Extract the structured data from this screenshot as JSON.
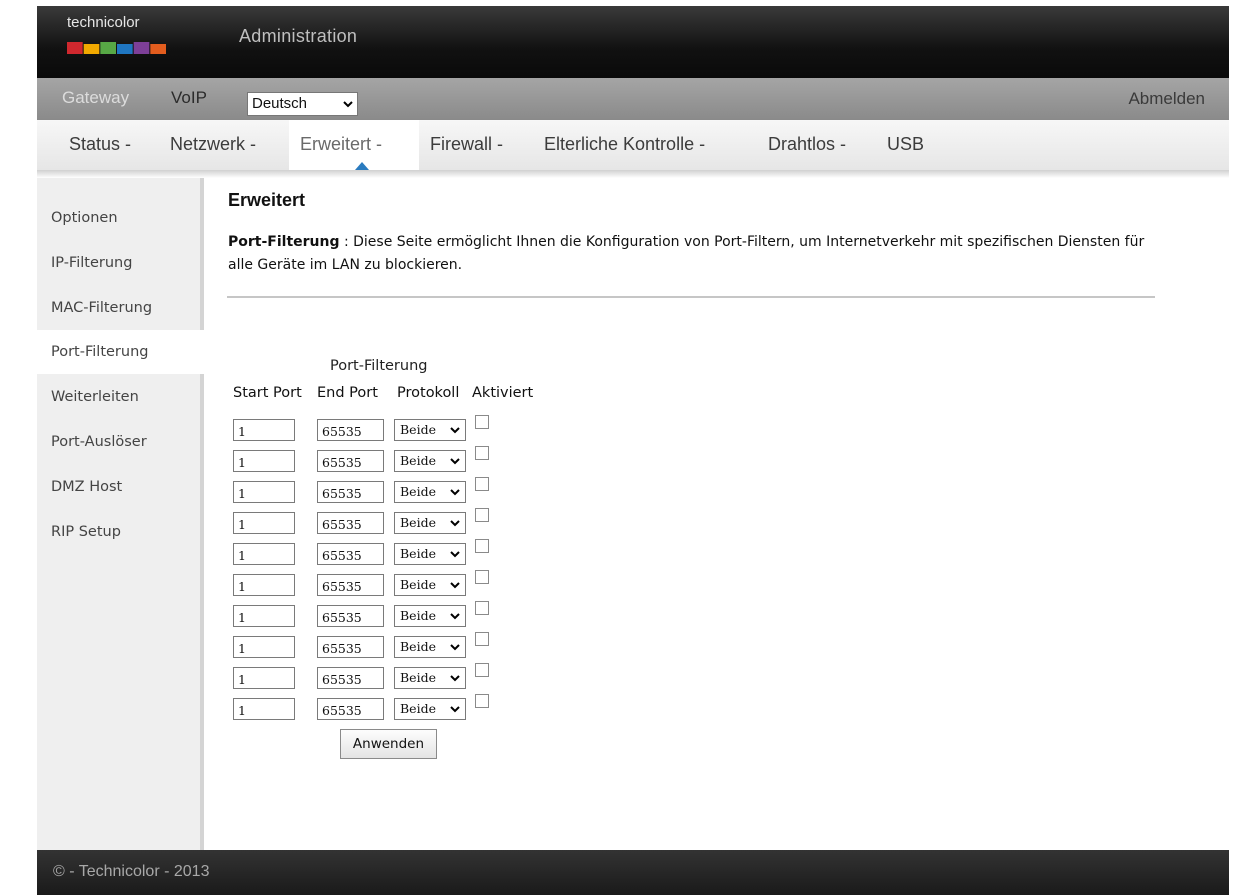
{
  "brand": {
    "logo_text": "technicolor",
    "bar_colors": [
      "#d0282e",
      "#f2a900",
      "#57a845",
      "#1f76c1",
      "#7d3f98",
      "#e35d1e"
    ]
  },
  "header": {
    "title": "Administration"
  },
  "topnav": {
    "gateway": "Gateway",
    "voip": "VoIP",
    "language": "Deutsch",
    "logout": "Abmelden"
  },
  "tabs": [
    {
      "label": "Status -"
    },
    {
      "label": "Netzwerk -"
    },
    {
      "label": "Erweitert -",
      "active": true
    },
    {
      "label": "Firewall -"
    },
    {
      "label": "Elterliche Kontrolle -"
    },
    {
      "label": "Drahtlos -"
    },
    {
      "label": "USB"
    }
  ],
  "sidebar": [
    {
      "label": "Optionen"
    },
    {
      "label": "IP-Filterung"
    },
    {
      "label": "MAC-Filterung"
    },
    {
      "label": "Port-Filterung",
      "active": true
    },
    {
      "label": "Weiterleiten"
    },
    {
      "label": "Port-Auslöser"
    },
    {
      "label": "DMZ Host"
    },
    {
      "label": "RIP Setup"
    }
  ],
  "main": {
    "title": "Erweitert",
    "desc_label": "Port-Filterung",
    "desc_sep": " : ",
    "desc_text": "Diese Seite ermöglicht Ihnen die Konfiguration von Port-Filtern, um Internetverkehr mit spezifischen Diensten für alle Geräte im LAN zu blockieren.",
    "table_title": "Port-Filterung",
    "columns": [
      "Start Port",
      "End Port",
      "Protokoll",
      "Aktiviert"
    ],
    "rows": [
      {
        "start": "1",
        "end": "65535",
        "protocol": "Beide",
        "enabled": false
      },
      {
        "start": "1",
        "end": "65535",
        "protocol": "Beide",
        "enabled": false
      },
      {
        "start": "1",
        "end": "65535",
        "protocol": "Beide",
        "enabled": false
      },
      {
        "start": "1",
        "end": "65535",
        "protocol": "Beide",
        "enabled": false
      },
      {
        "start": "1",
        "end": "65535",
        "protocol": "Beide",
        "enabled": false
      },
      {
        "start": "1",
        "end": "65535",
        "protocol": "Beide",
        "enabled": false
      },
      {
        "start": "1",
        "end": "65535",
        "protocol": "Beide",
        "enabled": false
      },
      {
        "start": "1",
        "end": "65535",
        "protocol": "Beide",
        "enabled": false
      },
      {
        "start": "1",
        "end": "65535",
        "protocol": "Beide",
        "enabled": false
      },
      {
        "start": "1",
        "end": "65535",
        "protocol": "Beide",
        "enabled": false
      }
    ],
    "apply_label": "Anwenden"
  },
  "footer": {
    "text": "© - Technicolor - 2013"
  },
  "colors": {
    "accent": "#2a7bbf",
    "header_bg": "#111111",
    "topnav_bg": "#999999",
    "footer_bg": "#222222"
  }
}
